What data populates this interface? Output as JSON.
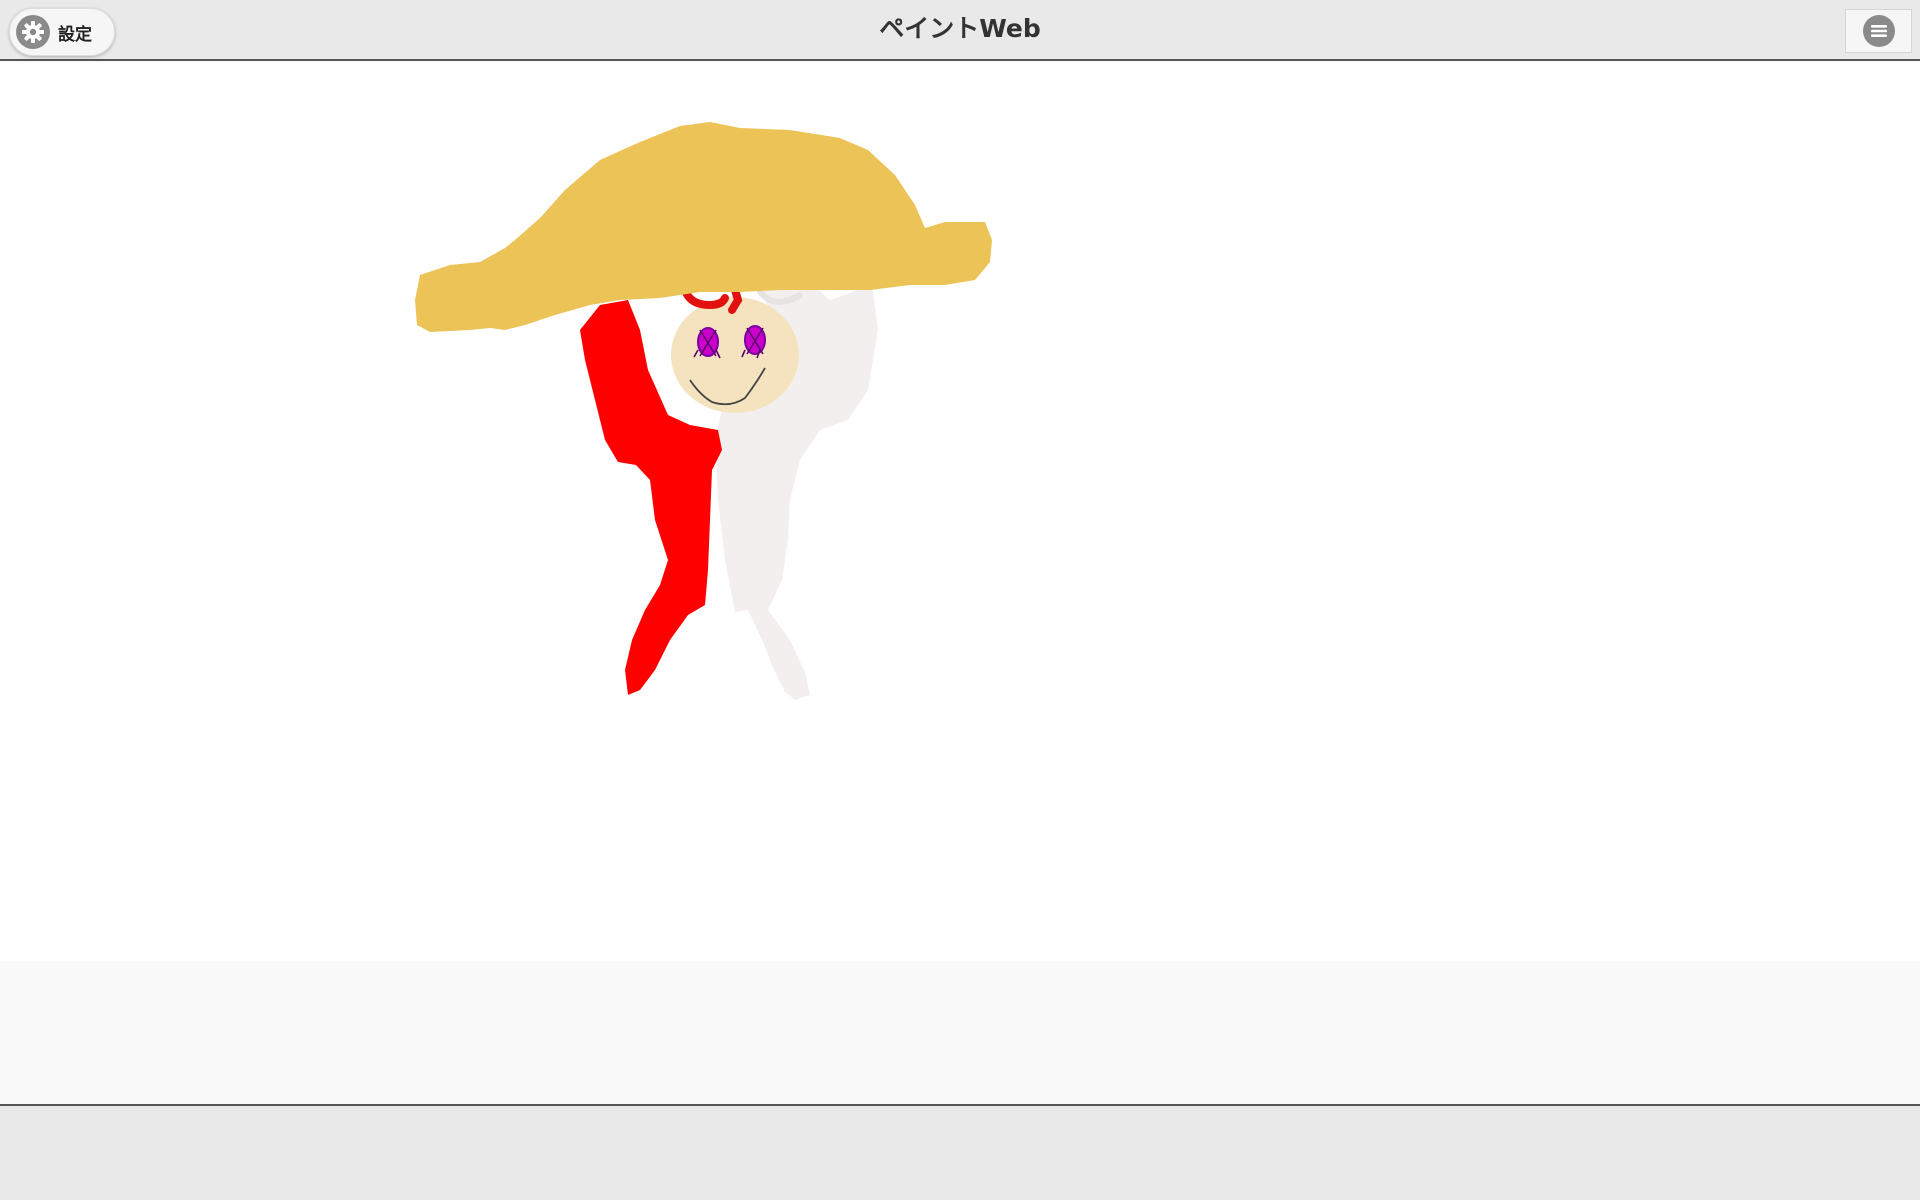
{
  "header": {
    "title": "ペイントWeb",
    "settings_label": "設定",
    "settings_icon": "gear-icon",
    "menu_icon": "hamburger-menu-icon"
  },
  "canvas": {
    "drawing_colors": {
      "hat": "#ecc357",
      "left_body": "#ff0000",
      "right_body": "#f4efef",
      "face": "#f5e3c0",
      "eyes": "#cc00cc",
      "mouth": "#444444"
    }
  },
  "theme": {
    "header_bg": "#e9e9e9",
    "canvas_bg": "#ffffff",
    "page_bg": "#f9f9f9"
  }
}
